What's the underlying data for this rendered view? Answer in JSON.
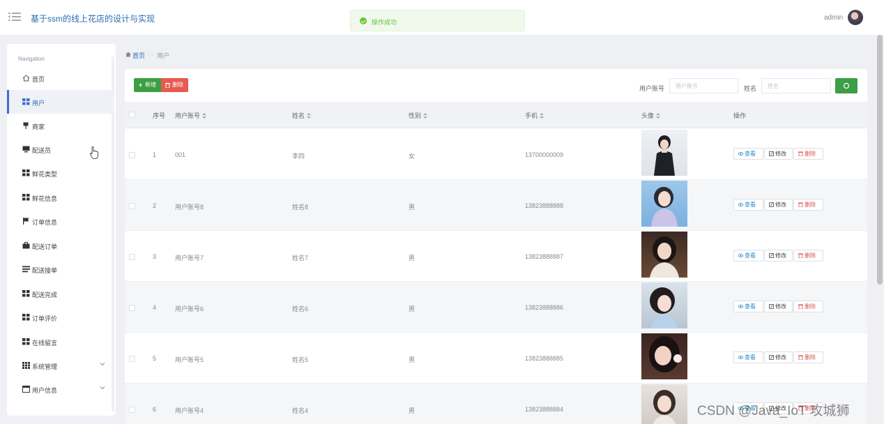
{
  "header": {
    "title": "基于ssm的线上花店的设计与实现",
    "user_name": "admin",
    "menu_icon": "menu-icon",
    "avatar_icon": "avatar"
  },
  "toast": {
    "message": "操作成功",
    "icon": "success-check-icon",
    "color": "#67c23a"
  },
  "sidebar": {
    "heading": "Navigation",
    "items": [
      {
        "label": "首页",
        "icon": "home-icon",
        "active": false
      },
      {
        "label": "用户",
        "icon": "grid-icon",
        "active": true
      },
      {
        "label": "商家",
        "icon": "pin-icon",
        "active": false
      },
      {
        "label": "配送员",
        "icon": "monitor-icon",
        "active": false
      },
      {
        "label": "鲜花类型",
        "icon": "grid-icon",
        "active": false
      },
      {
        "label": "鲜花信息",
        "icon": "grid-icon",
        "active": false
      },
      {
        "label": "订单信息",
        "icon": "flag-icon",
        "active": false
      },
      {
        "label": "配送订单",
        "icon": "briefcase-icon",
        "active": false
      },
      {
        "label": "配送接单",
        "icon": "list-icon",
        "active": false
      },
      {
        "label": "配送完成",
        "icon": "grid-icon",
        "active": false
      },
      {
        "label": "订单评价",
        "icon": "grid-icon",
        "active": false
      },
      {
        "label": "在线留言",
        "icon": "grid-icon",
        "active": false
      },
      {
        "label": "系统管理",
        "icon": "apps-icon",
        "active": false,
        "expandable": true
      },
      {
        "label": "用户信息",
        "icon": "id-card-icon",
        "active": false,
        "expandable": true
      }
    ]
  },
  "breadcrumb": {
    "home": "首页",
    "separator": "- -",
    "current": "用户"
  },
  "toolbar": {
    "add_label": "新增",
    "delete_label": "删除",
    "filter_account_label": "用户账号",
    "filter_account_placeholder": "用户账号",
    "filter_name_label": "姓名",
    "filter_name_placeholder": "姓名",
    "search_icon": "search-icon"
  },
  "table": {
    "columns": [
      "序号",
      "用户账号",
      "姓名",
      "性别",
      "手机",
      "头像",
      "操作"
    ],
    "actions": {
      "view": "查看",
      "edit": "修改",
      "delete": "删除"
    },
    "rows": [
      {
        "index": "1",
        "account": "001",
        "name": "李四",
        "gender": "女",
        "phone": "13700000009"
      },
      {
        "index": "2",
        "account": "用户账号8",
        "name": "姓名8",
        "gender": "男",
        "phone": "13823888888"
      },
      {
        "index": "3",
        "account": "用户账号7",
        "name": "姓名7",
        "gender": "男",
        "phone": "13823888887"
      },
      {
        "index": "4",
        "account": "用户账号6",
        "name": "姓名6",
        "gender": "男",
        "phone": "13823888886"
      },
      {
        "index": "5",
        "account": "用户账号5",
        "name": "姓名5",
        "gender": "男",
        "phone": "13823888885"
      },
      {
        "index": "6",
        "account": "用户账号4",
        "name": "姓名4",
        "gender": "男",
        "phone": "13823888884"
      }
    ]
  },
  "watermark": "CSDN @Java_IoT 攻城狮",
  "colors": {
    "primary_blue": "#2b6cb0",
    "add_green": "#3c9e45",
    "delete_red": "#e75a4f"
  }
}
